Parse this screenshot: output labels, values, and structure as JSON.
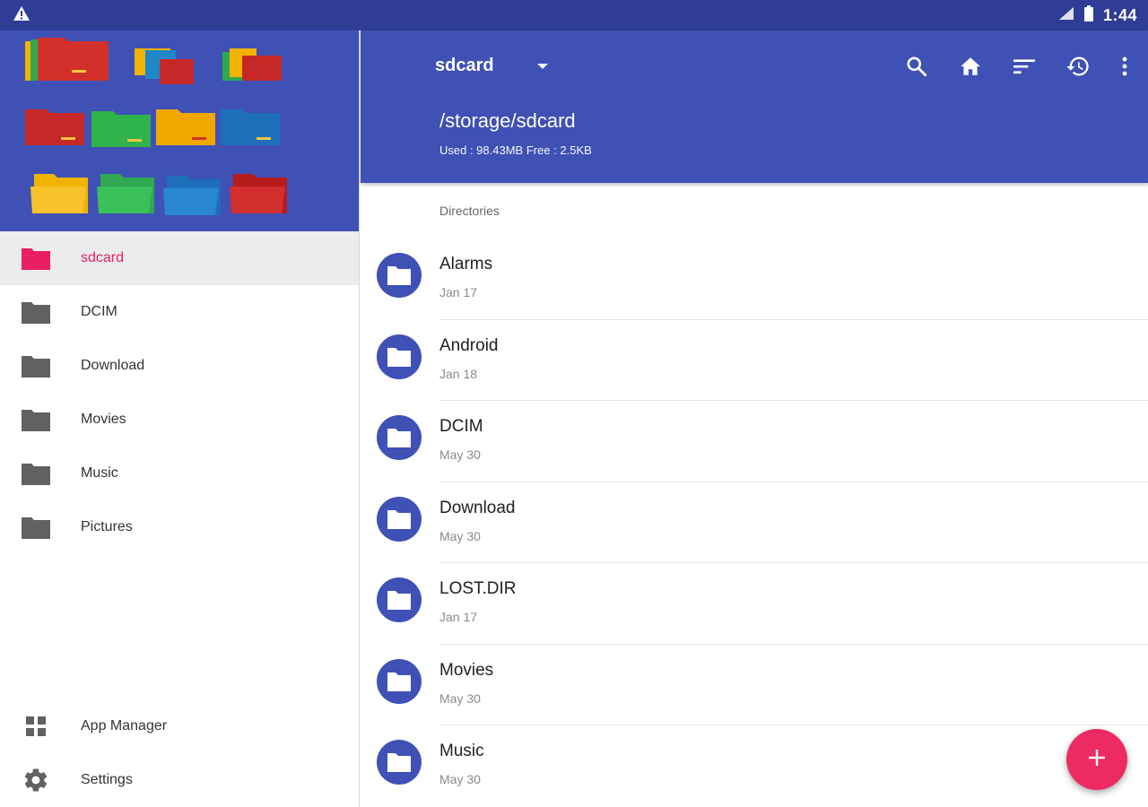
{
  "status_bar": {
    "time": "1:44",
    "alert_icon": "warning-icon",
    "signal_icon": "signal-icon",
    "battery_icon": "battery-icon"
  },
  "colors": {
    "primary": "#3f51b5",
    "primary_dark": "#2f3d96",
    "accent": "#e91e63"
  },
  "drawer": {
    "items": [
      {
        "label": "sdcard",
        "icon": "folder-icon",
        "active": true
      },
      {
        "label": "DCIM",
        "icon": "folder-icon",
        "active": false
      },
      {
        "label": "Download",
        "icon": "folder-icon",
        "active": false
      },
      {
        "label": "Movies",
        "icon": "folder-icon",
        "active": false
      },
      {
        "label": "Music",
        "icon": "folder-icon",
        "active": false
      },
      {
        "label": "Pictures",
        "icon": "folder-icon",
        "active": false
      }
    ],
    "bottom_items": [
      {
        "label": "App Manager",
        "icon": "grid-icon"
      },
      {
        "label": "Settings",
        "icon": "gear-icon"
      }
    ]
  },
  "appbar": {
    "title": "sdcard",
    "path": "/storage/sdcard",
    "usage": "Used : 98.43MB Free : 2.5KB",
    "actions": [
      "search-icon",
      "home-icon",
      "sort-icon",
      "history-icon",
      "more-vert-icon"
    ]
  },
  "main": {
    "section_label": "Directories",
    "directories": [
      {
        "name": "Alarms",
        "date": "Jan 17"
      },
      {
        "name": "Android",
        "date": "Jan 18"
      },
      {
        "name": "DCIM",
        "date": "May 30"
      },
      {
        "name": "Download",
        "date": "May 30"
      },
      {
        "name": "LOST.DIR",
        "date": "Jan 17"
      },
      {
        "name": "Movies",
        "date": "May 30"
      },
      {
        "name": "Music",
        "date": "May 30"
      }
    ]
  },
  "fab": {
    "icon": "plus-icon"
  }
}
